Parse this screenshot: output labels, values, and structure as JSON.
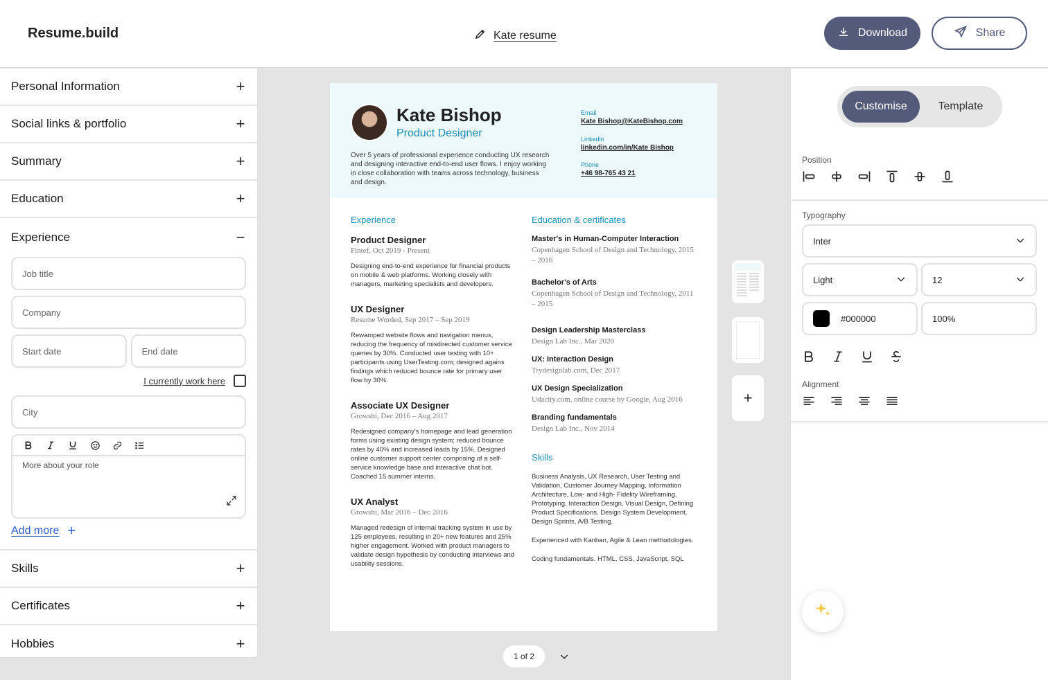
{
  "header": {
    "logo": "Resume.build",
    "doc_title": "Kate resume",
    "download_label": "Download",
    "share_label": "Share"
  },
  "left": {
    "sections_top": [
      {
        "label": "Personal Information"
      },
      {
        "label": "Social links & portfolio"
      },
      {
        "label": "Summary"
      },
      {
        "label": "Education"
      }
    ],
    "experience": {
      "label": "Experience",
      "job_title_ph": "Job title",
      "company_ph": "Company",
      "start_ph": "Start date",
      "end_ph": "End date",
      "current_label": "I currently work here",
      "city_ph": "City",
      "more_ph": "More about your role",
      "add_more": "Add more"
    },
    "sections_bottom": [
      {
        "label": "Skills"
      },
      {
        "label": "Certificates"
      },
      {
        "label": "Hobbies"
      }
    ]
  },
  "right": {
    "tab_customise": "Customise",
    "tab_template": "Template",
    "position_label": "Position",
    "typography_label": "Typography",
    "font": "Inter",
    "weight": "Light",
    "size": "12",
    "color_hex": "#000000",
    "color_value": "#000000",
    "opacity": "100%",
    "alignment_label": "Alignment"
  },
  "pager": {
    "label": "1 of 2"
  },
  "resume": {
    "name": "Kate Bishop",
    "role": "Product Designer",
    "intro": "Over 5 years of professional experience conducting UX research and designing interactive end-to-end user flows. I enjoy working in close collaboration with teams across technology, business and design.",
    "contact": [
      {
        "k": "Email",
        "v": "Kate Bishop@KateBishop.com"
      },
      {
        "k": "Linkedin",
        "v": "linkedin.com/in/Kate Bishop"
      },
      {
        "k": "Phone",
        "v": "+46 98-765 43 21"
      }
    ],
    "experience_heading": "Experience",
    "jobs": [
      {
        "t": "Product Designer",
        "m": "Fintef, Oct 2019 - Present",
        "d": "Designing end-to-end experience for financial products on mobile & web platforms. Working closely with managers, marketing specialists and developers."
      },
      {
        "t": "UX Designer",
        "m": "Resume Worded, Sep 2017 – Sep 2019",
        "d": "Rewamped website flows and navigation menus, reducing the frequency of misdirected customer service queries by 30%. Conducted user testing with 10+ participants using UserTesting.com; designed agains findings which reduced bounce rate for primary user flow by 30%."
      },
      {
        "t": "Associate UX Designer",
        "m": "Growshi, Dec 2016 – Aug 2017",
        "d": "Redesigned company's homepage and lead generation forms using existing design system; reduced bounce rates by 40% and increased leads by 15%. Designed online customer support center comprising of a self-service knowledge base and interactive chat bot. Coached 15 summer interns."
      },
      {
        "t": "UX Analyst",
        "m": "Growshi, Mar 2016 – Dec 2016",
        "d": "Managed redesign of internal tracking system in use by 125 employees, resulting in 20+ new features and 25% higher engagement. Worked with product managers to validate design hypothesis by conducting interviews and usability sessions."
      }
    ],
    "education_heading": "Education & certificates",
    "education": [
      {
        "t": "Master's in Human-Computer Interaction",
        "m": "Copenhagen School of Design and Technology, 2015 – 2016"
      },
      {
        "t": "Bachelor's of Arts",
        "m": "Copenhagen School of Design and Technology, 2011 – 2015"
      },
      {
        "t": "Design Leadership Masterclass",
        "m": "Design Lab Inc., Mar 2020"
      },
      {
        "t": "UX: Interaction Design",
        "m": "Trydesignlab.com, Dec 2017"
      },
      {
        "t": "UX Design Specialization",
        "m": "Udacity.com, online course by Google, Aug 2016"
      },
      {
        "t": "Branding fundamentals",
        "m": "Design Lab Inc., Nov 2014"
      }
    ],
    "skills_heading": "Skills",
    "skills": [
      "Business Analysis, UX Research, User Testing and Validation, Customer Journey Mapping, Information Architecture, Low- and High- Fidelity Wireframing, Prototyping, Interaction Design, Visual Design, Defining Product Specifications, Design System Development, Design Sprints, A/B Testing.",
      "Experienced with Kanban, Agile & Lean methodologies.",
      "Coding fundamentals. HTML, CSS, JavaScript, SQL"
    ]
  },
  "colors": {
    "accent": "#545b7a",
    "resume_accent": "#1d8fb4",
    "link": "#2f5fd0"
  }
}
